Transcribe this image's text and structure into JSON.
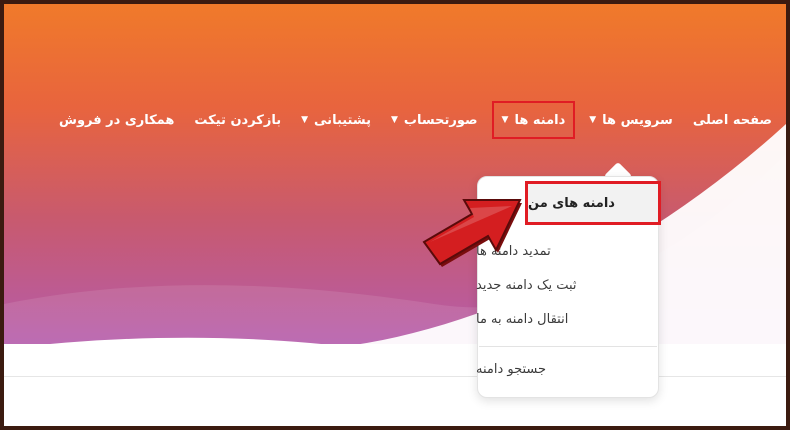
{
  "nav": {
    "items": [
      {
        "label": "صفحه اصلی",
        "has_caret": false
      },
      {
        "label": "سرویس ها",
        "has_caret": true
      },
      {
        "label": "دامنه ها",
        "has_caret": true
      },
      {
        "label": "صورتحساب",
        "has_caret": true
      },
      {
        "label": "پشتیبانی",
        "has_caret": true
      },
      {
        "label": "بازکردن تیکت",
        "has_caret": false
      },
      {
        "label": "همکاری در فروش",
        "has_caret": false
      }
    ],
    "caret_glyph": "▼"
  },
  "dropdown": {
    "items": [
      {
        "label": "دامنه های من"
      },
      {
        "label": "تمدید دامنه ها"
      },
      {
        "label": "ثبت یک دامنه جدید"
      },
      {
        "label": "انتقال دامنه به ما"
      },
      {
        "label": "جستجو دامنه"
      }
    ]
  },
  "colors": {
    "highlight_border": "#e01c24",
    "arrow_fill": "#d41e20",
    "gradient_top": "#f07a2a",
    "gradient_bottom": "#b45cae"
  }
}
